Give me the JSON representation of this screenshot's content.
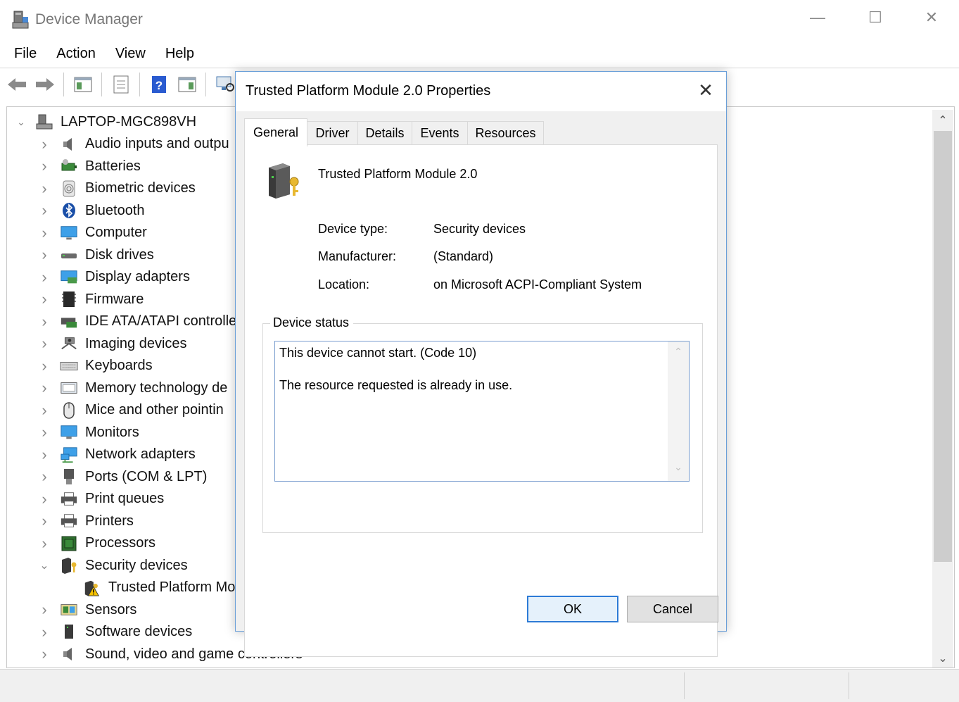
{
  "window": {
    "title": "Device Manager",
    "controls": {
      "minimize": "—",
      "maximize": "☐",
      "close": "✕"
    }
  },
  "menu": [
    "File",
    "Action",
    "View",
    "Help"
  ],
  "toolbar": {
    "buttons": [
      "back-icon",
      "forward-icon",
      "show-hide-tree-icon",
      "properties-icon",
      "help-icon",
      "console-tree-icon",
      "scan-hardware-icon"
    ]
  },
  "tree": {
    "root": {
      "label": "LAPTOP-MGC898VH",
      "expanded": true
    },
    "items": [
      {
        "label": "Audio inputs and outpu",
        "icon": "speaker-icon",
        "expanded": false
      },
      {
        "label": "Batteries",
        "icon": "battery-icon",
        "expanded": false
      },
      {
        "label": "Biometric devices",
        "icon": "fingerprint-icon",
        "expanded": false
      },
      {
        "label": "Bluetooth",
        "icon": "bluetooth-icon",
        "expanded": false
      },
      {
        "label": "Computer",
        "icon": "computer-icon",
        "expanded": false
      },
      {
        "label": "Disk drives",
        "icon": "disk-drive-icon",
        "expanded": false
      },
      {
        "label": "Display adapters",
        "icon": "display-adapter-icon",
        "expanded": false
      },
      {
        "label": "Firmware",
        "icon": "firmware-icon",
        "expanded": false
      },
      {
        "label": "IDE ATA/ATAPI controller",
        "icon": "ide-controller-icon",
        "expanded": false
      },
      {
        "label": "Imaging devices",
        "icon": "camera-icon",
        "expanded": false
      },
      {
        "label": "Keyboards",
        "icon": "keyboard-icon",
        "expanded": false
      },
      {
        "label": "Memory technology de",
        "icon": "memory-icon",
        "expanded": false
      },
      {
        "label": "Mice and other pointin",
        "icon": "mouse-icon",
        "expanded": false
      },
      {
        "label": "Monitors",
        "icon": "monitor-icon",
        "expanded": false
      },
      {
        "label": "Network adapters",
        "icon": "network-icon",
        "expanded": false
      },
      {
        "label": "Ports (COM & LPT)",
        "icon": "port-icon",
        "expanded": false
      },
      {
        "label": "Print queues",
        "icon": "printer-icon",
        "expanded": false
      },
      {
        "label": "Printers",
        "icon": "printer-icon",
        "expanded": false
      },
      {
        "label": "Processors",
        "icon": "processor-icon",
        "expanded": false
      },
      {
        "label": "Security devices",
        "icon": "security-device-icon",
        "expanded": true
      },
      {
        "label": "Trusted Platform Mo",
        "icon": "tpm-warning-icon",
        "child": true
      },
      {
        "label": "Sensors",
        "icon": "sensor-icon",
        "expanded": false
      },
      {
        "label": "Software devices",
        "icon": "software-device-icon",
        "expanded": false
      },
      {
        "label": "Sound, video and game controllers",
        "icon": "speaker-icon",
        "expanded": false
      }
    ]
  },
  "dialog": {
    "title": "Trusted Platform Module 2.0 Properties",
    "close": "✕",
    "tabs": [
      "General",
      "Driver",
      "Details",
      "Events",
      "Resources"
    ],
    "active_tab": "General",
    "device_name": "Trusted Platform Module 2.0",
    "properties": [
      {
        "label": "Device type:",
        "value": "Security devices"
      },
      {
        "label": "Manufacturer:",
        "value": "(Standard)"
      },
      {
        "label": "Location:",
        "value": "on Microsoft ACPI-Compliant System"
      }
    ],
    "status_group_label": "Device status",
    "status_lines": [
      "This device cannot start. (Code 10)",
      "The resource requested is already in use."
    ],
    "ok": "OK",
    "cancel": "Cancel"
  },
  "colors": {
    "accent": "#2d7bd6",
    "dialog_bg": "#f0f0f0",
    "status_border": "#7a9ecf"
  }
}
